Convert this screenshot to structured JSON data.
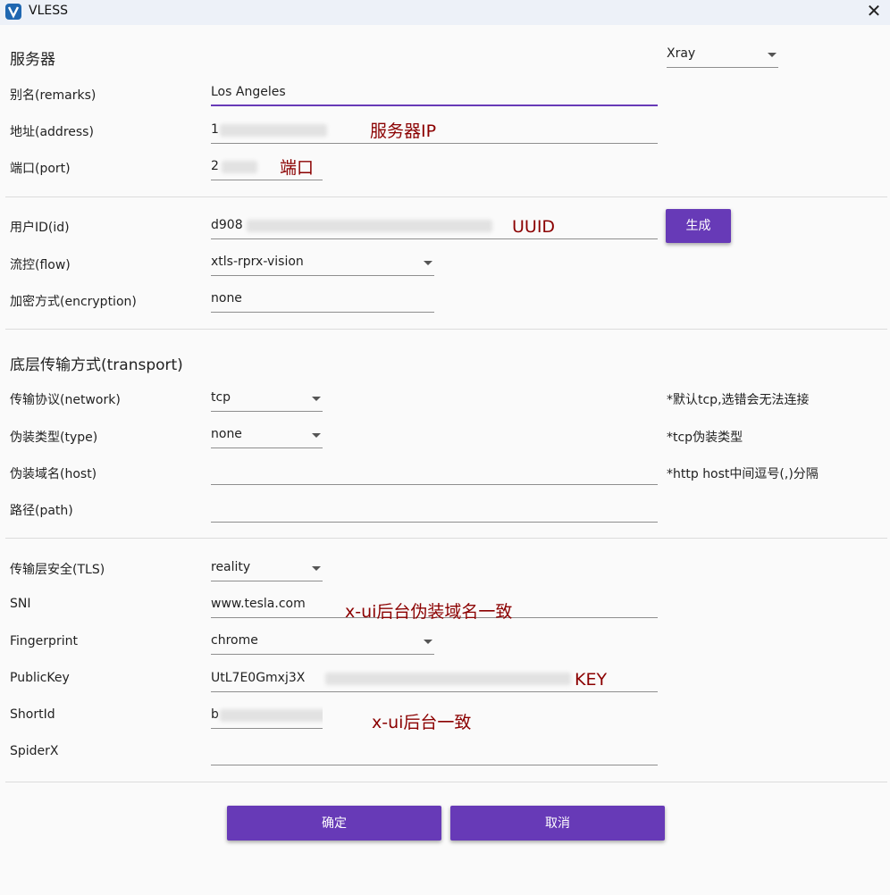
{
  "window": {
    "title": "VLESS",
    "close_label": "✕"
  },
  "server_section": {
    "heading": "服务器",
    "core_value": "Xray"
  },
  "fields": {
    "remarks": {
      "label": "别名(remarks)",
      "value": "Los Angeles"
    },
    "address": {
      "label": "地址(address)",
      "value": "1"
    },
    "port": {
      "label": "端口(port)",
      "value": "2"
    },
    "id": {
      "label": "用户ID(id)",
      "value": "d908"
    },
    "flow": {
      "label": "流控(flow)",
      "value": "xtls-rprx-vision"
    },
    "encryption": {
      "label": "加密方式(encryption)",
      "value": "none"
    }
  },
  "generate_button": "生成",
  "transport": {
    "heading": "底层传输方式(transport)",
    "network": {
      "label": "传输协议(network)",
      "value": "tcp",
      "note": "*默认tcp,选错会无法连接"
    },
    "type": {
      "label": "伪装类型(type)",
      "value": "none",
      "note": "*tcp伪装类型"
    },
    "host": {
      "label": "伪装域名(host)",
      "value": "",
      "note": "*http host中间逗号(,)分隔"
    },
    "path": {
      "label": "路径(path)",
      "value": ""
    }
  },
  "tls": {
    "security": {
      "label": "传输层安全(TLS)",
      "value": "reality"
    },
    "sni": {
      "label": "SNI",
      "value": "www.tesla.com"
    },
    "fingerprint": {
      "label": "Fingerprint",
      "value": "chrome"
    },
    "public_key": {
      "label": "PublicKey",
      "value": "UtL7E0Gmxj3X"
    },
    "short_id": {
      "label": "ShortId",
      "value": "b"
    },
    "spider_x": {
      "label": "SpiderX",
      "value": ""
    }
  },
  "annotations": {
    "server_ip": "服务器IP",
    "port": "端口",
    "uuid": "UUID",
    "sni": "x-ui后台伪装域名一致",
    "key": "KEY",
    "short_id": "x-ui后台一致"
  },
  "buttons": {
    "ok": "确定",
    "cancel": "取消"
  },
  "colors": {
    "accent": "#673ab7",
    "annotation": "#8b0000",
    "titlebar": "#edf1f8"
  }
}
